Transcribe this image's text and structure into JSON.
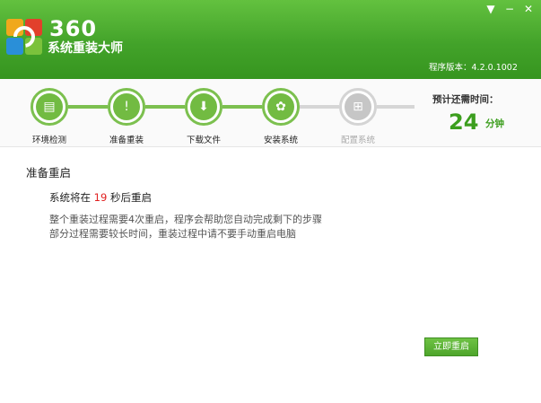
{
  "header": {
    "logo_number": "360",
    "logo_name": "系统重装大师",
    "version": "程序版本：4.2.0.1002",
    "window_controls": {
      "menu": "▼",
      "minimize": "−",
      "close": "✕"
    },
    "colors": {
      "brand_green": "#43a32a"
    }
  },
  "steps": [
    {
      "label": "环境检测",
      "icon": "document-icon",
      "glyph": "▤",
      "state": "done"
    },
    {
      "label": "准备重装",
      "icon": "clipboard-icon",
      "glyph": "!",
      "state": "done"
    },
    {
      "label": "下载文件",
      "icon": "download-icon",
      "glyph": "⬇",
      "state": "done"
    },
    {
      "label": "安装系统",
      "icon": "install-icon",
      "glyph": "✿",
      "state": "active"
    },
    {
      "label": "配置系统",
      "icon": "windows-icon",
      "glyph": "⊞",
      "state": "pending"
    }
  ],
  "eta": {
    "label": "预计还需时间：",
    "value": "24",
    "unit": "分钟"
  },
  "main": {
    "title": "准备重启",
    "countdown_prefix": "系统将在",
    "countdown_seconds": "19",
    "countdown_suffix": "秒后重启",
    "desc_line1": "整个重装过程需要4次重启，程序会帮助您自动完成剩下的步骤",
    "desc_line2": "部分过程需要较长时间，重装过程中请不要手动重启电脑",
    "restart_button": "立即重启"
  }
}
